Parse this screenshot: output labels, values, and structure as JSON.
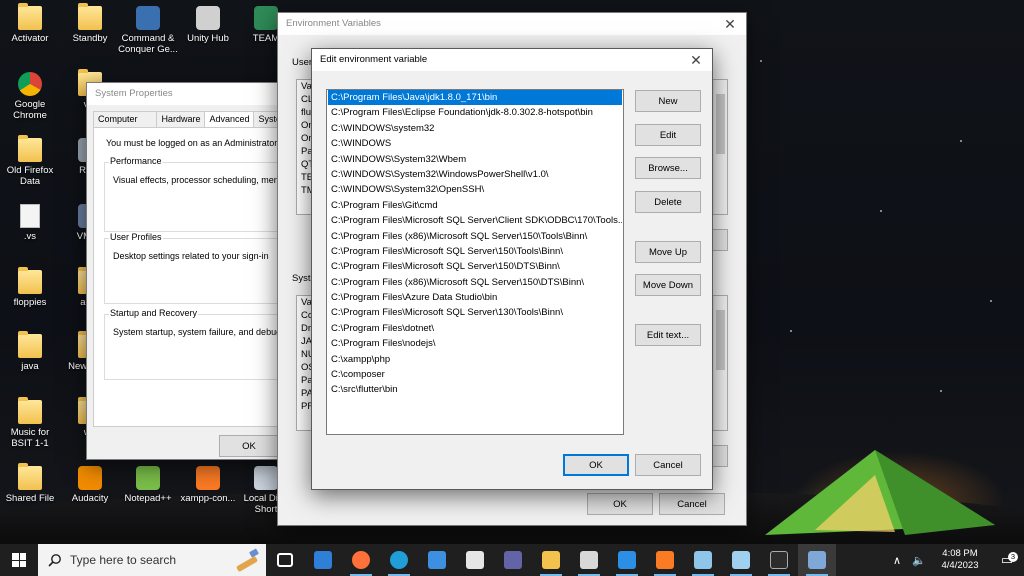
{
  "desktop": {
    "icons": [
      {
        "label": "Activator",
        "kind": "folder",
        "color": "#f2c14e"
      },
      {
        "label": "Standby",
        "kind": "folder",
        "color": "#f2c14e"
      },
      {
        "label": "Command & Conquer Ge...",
        "kind": "app",
        "color": "#3a6fb0"
      },
      {
        "label": "Unity Hub",
        "kind": "app",
        "color": "#d0d0d0"
      },
      {
        "label": "TEAM",
        "kind": "app",
        "color": "#2e8b57"
      },
      {
        "label": "Google Chrome",
        "kind": "chrome",
        "color": "#db4437"
      },
      {
        "label": "vm",
        "kind": "folder",
        "color": "#f2c14e"
      },
      {
        "label": "Old Firefox Data",
        "kind": "folder",
        "color": "#f2c14e"
      },
      {
        "label": "Recy",
        "kind": "app",
        "color": "#9aa6b2"
      },
      {
        "label": ".vs",
        "kind": "doc",
        "color": "#f4f4f4"
      },
      {
        "label": "VMwa",
        "kind": "app",
        "color": "#6a7fa0"
      },
      {
        "label": "floppies",
        "kind": "folder",
        "color": "#f2c14e"
      },
      {
        "label": "activ",
        "kind": "folder",
        "color": "#f2c14e"
      },
      {
        "label": "java",
        "kind": "folder",
        "color": "#f2c14e"
      },
      {
        "label": "New Docu",
        "kind": "folder",
        "color": "#f2c14e"
      },
      {
        "label": "Music for BSIT 1-1",
        "kind": "folder",
        "color": "#f2c14e"
      },
      {
        "label": "wo",
        "kind": "folder",
        "color": "#f2c14e"
      },
      {
        "label": "Shared File",
        "kind": "folder",
        "color": "#f2c14e"
      },
      {
        "label": "Audacity",
        "kind": "app",
        "color": "#f28c00"
      },
      {
        "label": "Notepad++",
        "kind": "app",
        "color": "#7bbf4a"
      },
      {
        "label": "xampp-con...",
        "kind": "app",
        "color": "#fb7a24"
      },
      {
        "label": "Local Dis - Short",
        "kind": "app",
        "color": "#cfd8e3"
      }
    ]
  },
  "system_properties": {
    "title": "System Properties",
    "tabs": [
      "Computer Name",
      "Hardware",
      "Advanced",
      "Syste"
    ],
    "active_tab": "Advanced",
    "admin_note": "You must be logged on as an Administrator to",
    "performance": {
      "title": "Performance",
      "desc": "Visual effects, processor scheduling, memor"
    },
    "user_profiles": {
      "title": "User Profiles",
      "desc": "Desktop settings related to your sign-in"
    },
    "startup_recovery": {
      "title": "Startup and Recovery",
      "desc": "System startup, system failure, and debuggi"
    },
    "ok_label": "OK"
  },
  "environment_variables": {
    "title": "Environment Variables",
    "user_label": "User",
    "user_rows": [
      "Var",
      "CL",
      "flu",
      "On",
      "On",
      "Pat",
      "QT",
      "TE",
      "TM"
    ],
    "system_label": "Syste",
    "system_rows": [
      "Var",
      "Co",
      "Dri",
      "JAV",
      "NU",
      "OS",
      "Pat",
      "PA",
      "PR"
    ],
    "ok_label": "OK",
    "cancel_label": "Cancel"
  },
  "edit_dialog": {
    "title": "Edit environment variable",
    "paths": [
      "C:\\Program Files\\Java\\jdk1.8.0_171\\bin",
      "C:\\Program Files\\Eclipse Foundation\\jdk-8.0.302.8-hotspot\\bin",
      "C:\\WINDOWS\\system32",
      "C:\\WINDOWS",
      "C:\\WINDOWS\\System32\\Wbem",
      "C:\\WINDOWS\\System32\\WindowsPowerShell\\v1.0\\",
      "C:\\WINDOWS\\System32\\OpenSSH\\",
      "C:\\Program Files\\Git\\cmd",
      "C:\\Program Files\\Microsoft SQL Server\\Client SDK\\ODBC\\170\\Tools...",
      "C:\\Program Files (x86)\\Microsoft SQL Server\\150\\Tools\\Binn\\",
      "C:\\Program Files\\Microsoft SQL Server\\150\\Tools\\Binn\\",
      "C:\\Program Files\\Microsoft SQL Server\\150\\DTS\\Binn\\",
      "C:\\Program Files (x86)\\Microsoft SQL Server\\150\\DTS\\Binn\\",
      "C:\\Program Files\\Azure Data Studio\\bin",
      "C:\\Program Files\\Microsoft SQL Server\\130\\Tools\\Binn\\",
      "C:\\Program Files\\dotnet\\",
      "C:\\Program Files\\nodejs\\",
      "C:\\xampp\\php",
      "C:\\composer",
      "C:\\src\\flutter\\bin"
    ],
    "selected_index": 0,
    "buttons": {
      "new": "New",
      "edit": "Edit",
      "browse": "Browse...",
      "delete": "Delete",
      "move_up": "Move Up",
      "move_down": "Move Down",
      "edit_text": "Edit text..."
    },
    "ok_label": "OK",
    "cancel_label": "Cancel"
  },
  "taskbar": {
    "search_placeholder": "Type here to search",
    "apps": [
      {
        "name": "task-view",
        "color": "#ffffff"
      },
      {
        "name": "mail",
        "color": "#2f7fd8"
      },
      {
        "name": "firefox",
        "color": "#ff7139"
      },
      {
        "name": "edge",
        "color": "#1f9ed8"
      },
      {
        "name": "store",
        "color": "#3d8fe0"
      },
      {
        "name": "settings",
        "color": "#e6e6e6"
      },
      {
        "name": "teams",
        "color": "#6264a7"
      },
      {
        "name": "file-explorer",
        "color": "#f2c14e"
      },
      {
        "name": "unity",
        "color": "#d8d8d8"
      },
      {
        "name": "vscode",
        "color": "#2b8fe6"
      },
      {
        "name": "xampp",
        "color": "#fb7a24"
      },
      {
        "name": "notepad",
        "color": "#8ec5e8"
      },
      {
        "name": "paint",
        "color": "#9fd0ef"
      },
      {
        "name": "terminal",
        "color": "#2c2c2c"
      },
      {
        "name": "system-properties",
        "color": "#7fa8d8"
      }
    ],
    "time": "4:08 PM",
    "date": "4/4/2023",
    "notification_count": "3"
  }
}
